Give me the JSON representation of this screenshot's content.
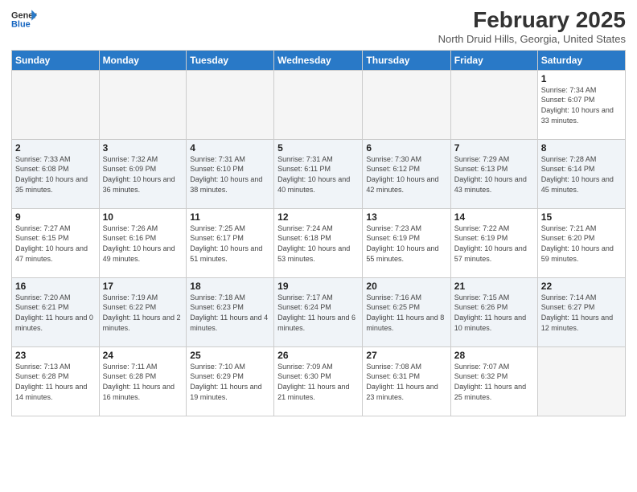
{
  "logo": {
    "line1": "General",
    "line2": "Blue"
  },
  "title": "February 2025",
  "location": "North Druid Hills, Georgia, United States",
  "weekdays": [
    "Sunday",
    "Monday",
    "Tuesday",
    "Wednesday",
    "Thursday",
    "Friday",
    "Saturday"
  ],
  "weeks": [
    [
      {
        "day": "",
        "info": ""
      },
      {
        "day": "",
        "info": ""
      },
      {
        "day": "",
        "info": ""
      },
      {
        "day": "",
        "info": ""
      },
      {
        "day": "",
        "info": ""
      },
      {
        "day": "",
        "info": ""
      },
      {
        "day": "1",
        "info": "Sunrise: 7:34 AM\nSunset: 6:07 PM\nDaylight: 10 hours and 33 minutes."
      }
    ],
    [
      {
        "day": "2",
        "info": "Sunrise: 7:33 AM\nSunset: 6:08 PM\nDaylight: 10 hours and 35 minutes."
      },
      {
        "day": "3",
        "info": "Sunrise: 7:32 AM\nSunset: 6:09 PM\nDaylight: 10 hours and 36 minutes."
      },
      {
        "day": "4",
        "info": "Sunrise: 7:31 AM\nSunset: 6:10 PM\nDaylight: 10 hours and 38 minutes."
      },
      {
        "day": "5",
        "info": "Sunrise: 7:31 AM\nSunset: 6:11 PM\nDaylight: 10 hours and 40 minutes."
      },
      {
        "day": "6",
        "info": "Sunrise: 7:30 AM\nSunset: 6:12 PM\nDaylight: 10 hours and 42 minutes."
      },
      {
        "day": "7",
        "info": "Sunrise: 7:29 AM\nSunset: 6:13 PM\nDaylight: 10 hours and 43 minutes."
      },
      {
        "day": "8",
        "info": "Sunrise: 7:28 AM\nSunset: 6:14 PM\nDaylight: 10 hours and 45 minutes."
      }
    ],
    [
      {
        "day": "9",
        "info": "Sunrise: 7:27 AM\nSunset: 6:15 PM\nDaylight: 10 hours and 47 minutes."
      },
      {
        "day": "10",
        "info": "Sunrise: 7:26 AM\nSunset: 6:16 PM\nDaylight: 10 hours and 49 minutes."
      },
      {
        "day": "11",
        "info": "Sunrise: 7:25 AM\nSunset: 6:17 PM\nDaylight: 10 hours and 51 minutes."
      },
      {
        "day": "12",
        "info": "Sunrise: 7:24 AM\nSunset: 6:18 PM\nDaylight: 10 hours and 53 minutes."
      },
      {
        "day": "13",
        "info": "Sunrise: 7:23 AM\nSunset: 6:19 PM\nDaylight: 10 hours and 55 minutes."
      },
      {
        "day": "14",
        "info": "Sunrise: 7:22 AM\nSunset: 6:19 PM\nDaylight: 10 hours and 57 minutes."
      },
      {
        "day": "15",
        "info": "Sunrise: 7:21 AM\nSunset: 6:20 PM\nDaylight: 10 hours and 59 minutes."
      }
    ],
    [
      {
        "day": "16",
        "info": "Sunrise: 7:20 AM\nSunset: 6:21 PM\nDaylight: 11 hours and 0 minutes."
      },
      {
        "day": "17",
        "info": "Sunrise: 7:19 AM\nSunset: 6:22 PM\nDaylight: 11 hours and 2 minutes."
      },
      {
        "day": "18",
        "info": "Sunrise: 7:18 AM\nSunset: 6:23 PM\nDaylight: 11 hours and 4 minutes."
      },
      {
        "day": "19",
        "info": "Sunrise: 7:17 AM\nSunset: 6:24 PM\nDaylight: 11 hours and 6 minutes."
      },
      {
        "day": "20",
        "info": "Sunrise: 7:16 AM\nSunset: 6:25 PM\nDaylight: 11 hours and 8 minutes."
      },
      {
        "day": "21",
        "info": "Sunrise: 7:15 AM\nSunset: 6:26 PM\nDaylight: 11 hours and 10 minutes."
      },
      {
        "day": "22",
        "info": "Sunrise: 7:14 AM\nSunset: 6:27 PM\nDaylight: 11 hours and 12 minutes."
      }
    ],
    [
      {
        "day": "23",
        "info": "Sunrise: 7:13 AM\nSunset: 6:28 PM\nDaylight: 11 hours and 14 minutes."
      },
      {
        "day": "24",
        "info": "Sunrise: 7:11 AM\nSunset: 6:28 PM\nDaylight: 11 hours and 16 minutes."
      },
      {
        "day": "25",
        "info": "Sunrise: 7:10 AM\nSunset: 6:29 PM\nDaylight: 11 hours and 19 minutes."
      },
      {
        "day": "26",
        "info": "Sunrise: 7:09 AM\nSunset: 6:30 PM\nDaylight: 11 hours and 21 minutes."
      },
      {
        "day": "27",
        "info": "Sunrise: 7:08 AM\nSunset: 6:31 PM\nDaylight: 11 hours and 23 minutes."
      },
      {
        "day": "28",
        "info": "Sunrise: 7:07 AM\nSunset: 6:32 PM\nDaylight: 11 hours and 25 minutes."
      },
      {
        "day": "",
        "info": ""
      }
    ]
  ]
}
